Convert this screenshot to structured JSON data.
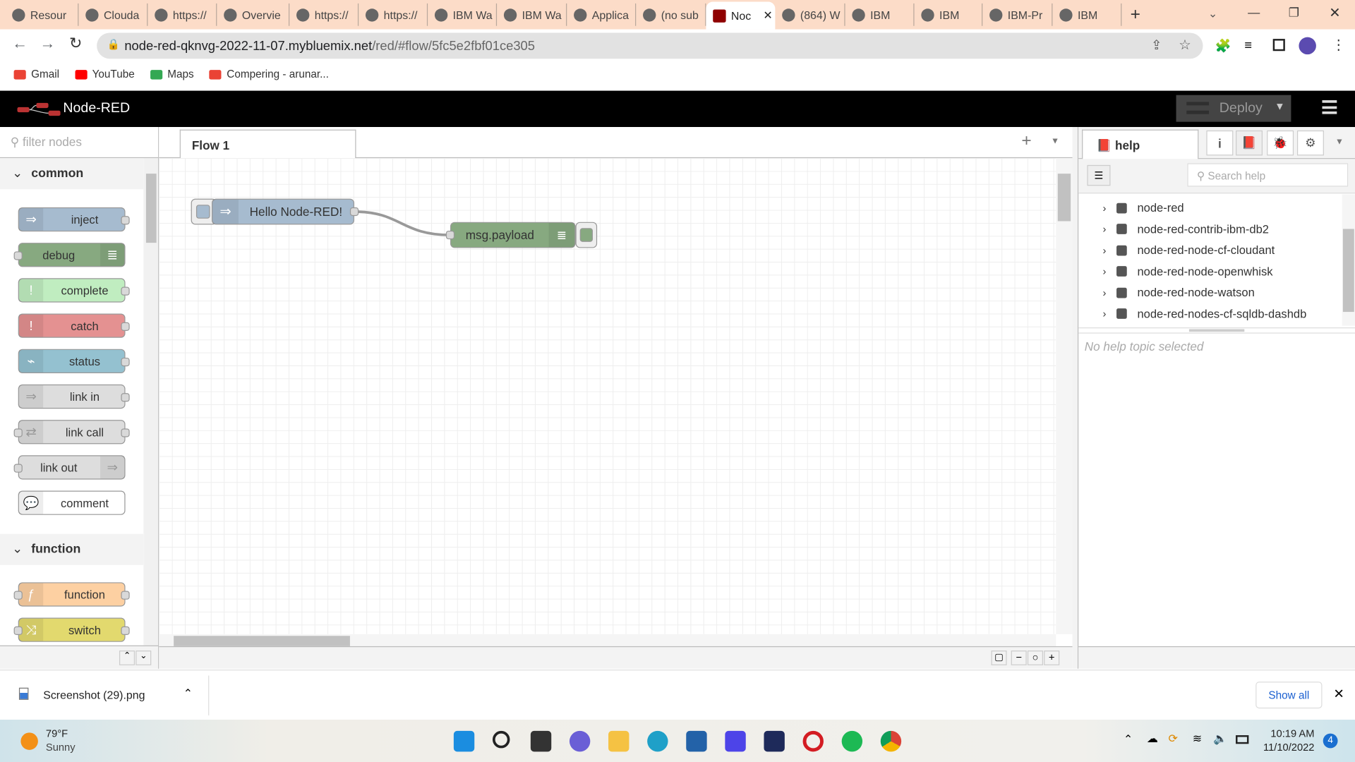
{
  "browser": {
    "tabs": [
      {
        "label": "Resour"
      },
      {
        "label": "Clouda"
      },
      {
        "label": "https://"
      },
      {
        "label": "Overvie"
      },
      {
        "label": "https://"
      },
      {
        "label": "https://"
      },
      {
        "label": "IBM Wa"
      },
      {
        "label": "IBM Wa"
      },
      {
        "label": "Applica"
      },
      {
        "label": "(no sub"
      },
      {
        "label": "Noc",
        "active": true
      },
      {
        "label": "(864) W"
      },
      {
        "label": "IBM"
      },
      {
        "label": "IBM"
      },
      {
        "label": "IBM-Pr"
      },
      {
        "label": "IBM"
      }
    ],
    "url_host": "node-red-qknvg-2022-11-07.mybluemix.net",
    "url_path": "/red/#flow/5fc5e2fbf01ce305",
    "bookmarks": [
      {
        "label": "Gmail"
      },
      {
        "label": "YouTube"
      },
      {
        "label": "Maps"
      },
      {
        "label": "Compering - arunar..."
      }
    ]
  },
  "app": {
    "title": "Node-RED",
    "deploy_label": "Deploy"
  },
  "palette": {
    "filter_placeholder": "filter nodes",
    "categories": [
      {
        "label": "common"
      },
      {
        "label": "function"
      }
    ],
    "nodes": [
      {
        "label": "inject",
        "color": "#a6bbcf",
        "icon": "arrow-icon"
      },
      {
        "label": "debug",
        "color": "#87a980",
        "icon": "list-icon"
      },
      {
        "label": "complete",
        "color": "#c0edc0",
        "icon": "exclamation-icon"
      },
      {
        "label": "catch",
        "color": "#e49191",
        "icon": "exclamation-icon"
      },
      {
        "label": "status",
        "color": "#94c1d0",
        "icon": "pulse-icon"
      },
      {
        "label": "link in",
        "color": "#dddddd",
        "icon": "link-in-icon"
      },
      {
        "label": "link call",
        "color": "#dddddd",
        "icon": "link-call-icon"
      },
      {
        "label": "link out",
        "color": "#dddddd",
        "icon": "link-out-icon"
      },
      {
        "label": "comment",
        "color": "#ffffff",
        "icon": "comment-icon"
      },
      {
        "label": "function",
        "color": "#fdd0a2",
        "icon": "function-icon"
      },
      {
        "label": "switch",
        "color": "#e2d96e",
        "icon": "switch-icon"
      }
    ]
  },
  "workspace": {
    "tabs": [
      {
        "label": "Flow 1"
      }
    ],
    "flow_nodes": [
      {
        "label": "Hello Node-RED!",
        "type": "inject",
        "color": "#a6bbcf"
      },
      {
        "label": "msg.payload",
        "type": "debug",
        "color": "#87a980"
      }
    ]
  },
  "sidebar": {
    "tab_label": "help",
    "search_placeholder": "Search help",
    "items": [
      {
        "label": "node-red"
      },
      {
        "label": "node-red-contrib-ibm-db2"
      },
      {
        "label": "node-red-node-cf-cloudant"
      },
      {
        "label": "node-red-node-openwhisk"
      },
      {
        "label": "node-red-node-watson"
      },
      {
        "label": "node-red-nodes-cf-sqldb-dashdb"
      }
    ],
    "empty_text": "No help topic selected"
  },
  "downloads": {
    "file": "Screenshot (29).png",
    "show_all": "Show all"
  },
  "taskbar": {
    "temp": "79°F",
    "weather": "Sunny",
    "time": "10:19 AM",
    "date": "11/10/2022",
    "badge": "4"
  }
}
